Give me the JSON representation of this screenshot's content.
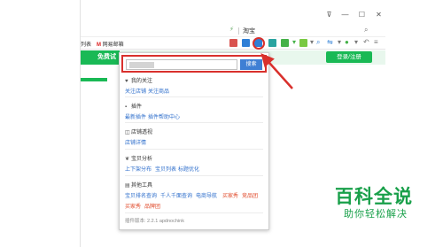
{
  "window": {
    "controls": {
      "pin": "⊽",
      "minimize": "—",
      "maximize": "☐",
      "close": "✕"
    }
  },
  "addressbar": {
    "search_text": "淘宝"
  },
  "bookmarks": {
    "item_1": "列表",
    "item_2": "网易邮箱"
  },
  "page": {
    "green_button": "免费试",
    "login_button": "登录/注册"
  },
  "popup": {
    "search_button": "搜索",
    "sections": [
      {
        "title": "我的关注",
        "icon": "heart-icon",
        "links": [
          "关注店铺",
          "关注商品"
        ]
      },
      {
        "title": "插件",
        "icon": "plugin-icon",
        "links": [
          "最新插件",
          "插件帮助中心"
        ]
      },
      {
        "title": "店铺透视",
        "icon": "chart-icon",
        "links": [
          "店铺详情"
        ]
      },
      {
        "title": "宝贝分析",
        "icon": "leaf-icon",
        "links": [
          "上下架分布",
          "宝贝列表",
          "标题优化"
        ]
      },
      {
        "title": "其他工具",
        "icon": "tools-icon",
        "links": [
          "宝贝排名查询",
          "千人千面查询",
          "电商导航",
          "买家秀",
          "竞品团",
          "买家秀",
          "品牌团"
        ]
      }
    ],
    "version": "插件版本: 2.2.1  apdnochink"
  },
  "watermark": {
    "title": "百科全说",
    "subtitle": "助你轻松解决"
  },
  "colors": {
    "accent_red": "#d9302c",
    "link_blue": "#2f6fcc",
    "brand_green": "#19b955",
    "button_blue": "#3f7fd4"
  }
}
